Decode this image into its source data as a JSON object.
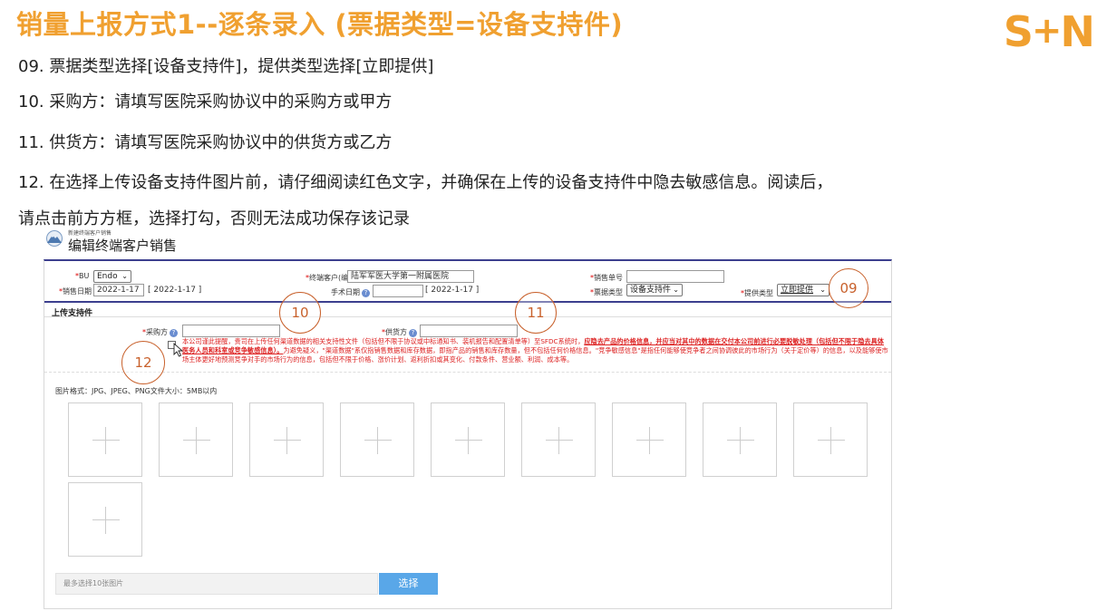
{
  "slide": {
    "title": "销量上报方式1--逐条录入 (票据类型=设备支持件)",
    "logo_left": "S",
    "logo_plus": "+",
    "logo_right": "N",
    "accent_color": "#f0a030"
  },
  "instructions": [
    "09. 票据类型选择[设备支持件]，提供类型选择[立即提供]",
    "10. 采购方：请填写医院采购协议中的采购方或甲方",
    "11. 供货方：请填写医院采购协议中的供货方或乙方",
    "12. 在选择上传设备支持件图片前，请仔细阅读红色文字，并确保在上传的设备支持件中隐去敏感信息。阅读后，",
    "请点击前方方框，选择打勾，否则无法成功保存该记录"
  ],
  "app": {
    "small_title": "新建终端客户销售",
    "title": "编辑终端客户销售",
    "icon": "mountain-icon"
  },
  "form": {
    "bu_label": "BU",
    "bu_value": "Endo",
    "sale_date_label": "销售日期",
    "sale_date_value": "2022-1-17",
    "sale_date_hint": "[ 2022-1-17 ]",
    "customer_label": "终端客户(编号/名称)",
    "customer_value": "陆军军医大学第一附属医院",
    "surgery_date_label": "手术日期",
    "surgery_date_hint": "[ 2022-1-17 ]",
    "sale_no_label": "销售单号",
    "sale_no_value": "",
    "ticket_type_label": "票据类型",
    "ticket_type_value": "设备支持件",
    "provide_type_label": "提供类型",
    "provide_type_value": "立即提供",
    "help_glyph": "?"
  },
  "upload_section": {
    "title": "上传支持件",
    "purchaser_label": "采购方",
    "purchaser_value": "",
    "supplier_label": "供货方",
    "supplier_value": "",
    "warning_part1": "本公司谨此提醒，贵司在上传任何渠道数据的相关支持性文件（包括但不限于协议或中标通知书、装机报告和配置清单等）至SFDC系统时，",
    "warning_bold": "应隐去产品的价格信息，并应当对其中的数据在交付本公司前进行必要脱敏处理（包括但不限于隐去具体医务人员和科室或竞争敏感信息）。",
    "warning_part2": "为避免疑义，\"渠道数据\"系仅指销售数据和库存数据，即指产品的销售和库存数量，但不包括任何价格信息。\"竞争敏感信息\"是指任何能够使竞争者之间协调彼此的市场行为（关于定价等）的信息，以及能够使市场主体更好地预测竞争对手的市场行为的信息，包括但不限于价格、涨价计划、返利折扣或其变化、付款条件、营业额、利润、成本等。",
    "format_hint": "图片格式：JPG、JPEG、PNG文件大小：5MB以内",
    "file_placeholder": "最多选择10张图片",
    "choose_label": "选择",
    "upload_tile_count": 10
  },
  "callouts": [
    "09",
    "10",
    "11",
    "12"
  ]
}
